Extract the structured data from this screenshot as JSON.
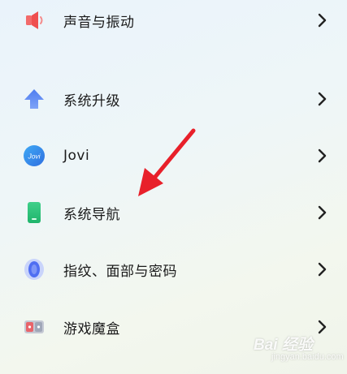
{
  "settings": {
    "items": [
      {
        "label": "声音与振动",
        "icon": "speaker-icon"
      },
      {
        "label": "系统升级",
        "icon": "upgrade-arrow-icon"
      },
      {
        "label": "Jovi",
        "icon": "jovi-icon",
        "icon_text": "Jovi"
      },
      {
        "label": "系统导航",
        "icon": "phone-navigation-icon"
      },
      {
        "label": "指纹、面部与密码",
        "icon": "fingerprint-icon"
      },
      {
        "label": "游戏魔盒",
        "icon": "game-box-icon"
      }
    ]
  },
  "annotation": {
    "arrow_color": "#e8202a"
  },
  "watermark": {
    "text": "Bai 经验",
    "sub": "jingyan.baidu.com"
  }
}
